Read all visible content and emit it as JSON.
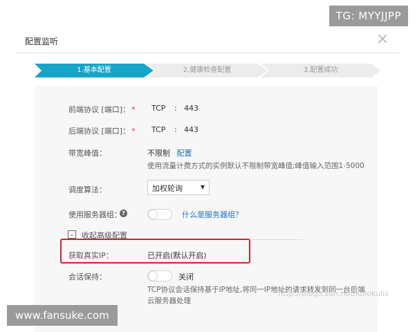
{
  "overlay": {
    "tg_badge": "TG: MYYJJPP",
    "site_badge": "www.fansuke.com",
    "watermark": "http://blog.csdn.net/Kolokulis"
  },
  "dialog": {
    "title": "配置监听",
    "close_icon": "close-icon"
  },
  "steps": [
    {
      "label": "1.基本配置",
      "active": true
    },
    {
      "label": "2.健康检查配置",
      "active": false
    },
    {
      "label": "3.配置成功",
      "active": false
    }
  ],
  "colors": {
    "step_active": "#16a5c9",
    "step_inactive": "#ececec",
    "link": "#1a73c9",
    "required": "#e23b3b",
    "highlight": "#d8202a"
  },
  "form": {
    "frontend": {
      "label": "前端协议 [端口]：",
      "required": "*",
      "protocol": "TCP",
      "sep": ":",
      "port": "443"
    },
    "backend": {
      "label": "后端协议 [端口]：",
      "required": "*",
      "protocol": "TCP",
      "sep": ":",
      "port": "443"
    },
    "bandwidth": {
      "label": "带宽峰值：",
      "value": "不限制",
      "link": "配置",
      "hint": "使用流量计费方式的实例默认不限制带宽峰值;峰值输入范围1-5000"
    },
    "algorithm": {
      "label": "调度算法：",
      "selected": "加权轮询"
    },
    "server_group": {
      "label": "使用服务器组：",
      "link": "什么是服务器组？",
      "enabled": false
    },
    "advanced": {
      "label": "收起高级配置"
    },
    "real_ip": {
      "label": "获取真实IP：",
      "value": "已开启(默认开启)"
    },
    "session": {
      "label": "会话保持：",
      "toggle_label": "关闭",
      "enabled": false,
      "hint_line1": "TCP协议会话保持基于IP地址,将同一IP地址的请求转发到同一台后端",
      "hint_line2": "云服务器处理"
    }
  }
}
